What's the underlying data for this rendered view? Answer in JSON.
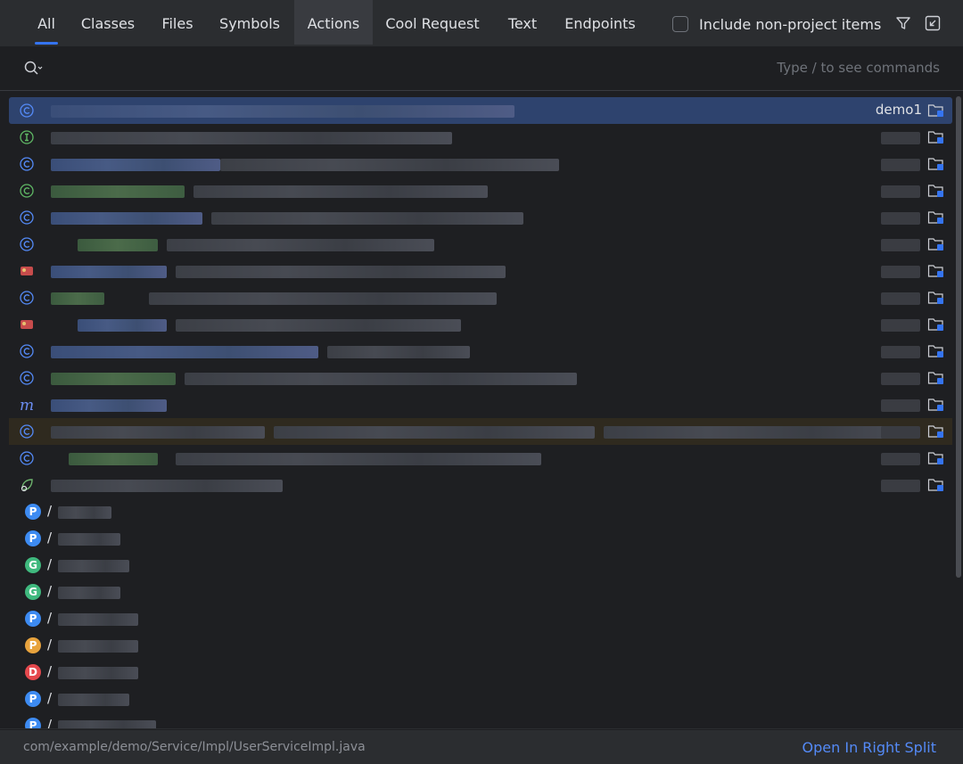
{
  "tabs": [
    {
      "label": "All"
    },
    {
      "label": "Classes"
    },
    {
      "label": "Files"
    },
    {
      "label": "Symbols"
    },
    {
      "label": "Actions"
    },
    {
      "label": "Cool Request"
    },
    {
      "label": "Text"
    },
    {
      "label": "Endpoints"
    }
  ],
  "include_non_project": {
    "label": "Include non-project items",
    "checked": false
  },
  "toolbar_icons": [
    "filter-icon",
    "collapse-window-icon"
  ],
  "search": {
    "value": "",
    "hint": "Type / to see commands"
  },
  "results": [
    {
      "icon": "class",
      "name": "",
      "module": "demo1",
      "selected": true
    },
    {
      "icon": "interface",
      "name": "",
      "module": ""
    },
    {
      "icon": "class",
      "name": "",
      "module": ""
    },
    {
      "icon": "class-green",
      "name": "",
      "module": ""
    },
    {
      "icon": "class",
      "name": "",
      "module": ""
    },
    {
      "icon": "class",
      "name": "",
      "module": ""
    },
    {
      "icon": "image",
      "name": "",
      "module": ""
    },
    {
      "icon": "class",
      "name": "",
      "module": ""
    },
    {
      "icon": "image",
      "name": "",
      "module": ""
    },
    {
      "icon": "class",
      "name": "",
      "module": ""
    },
    {
      "icon": "class",
      "name": "",
      "module": ""
    },
    {
      "icon": "method",
      "name": "",
      "module": ""
    },
    {
      "icon": "class",
      "name": "",
      "module": "",
      "highlight": true
    },
    {
      "icon": "class",
      "name": "",
      "module": ""
    },
    {
      "icon": "spring",
      "name": "",
      "module": ""
    }
  ],
  "endpoints": [
    {
      "method": "P",
      "color": "#3d8bf2",
      "path": "/"
    },
    {
      "method": "P",
      "color": "#3d8bf2",
      "path": "/"
    },
    {
      "method": "G",
      "color": "#3fb97e",
      "path": "/"
    },
    {
      "method": "G",
      "color": "#3fb97e",
      "path": "/"
    },
    {
      "method": "P",
      "color": "#3d8bf2",
      "path": "/"
    },
    {
      "method": "P",
      "color": "#e8a33d",
      "path": "/"
    },
    {
      "method": "D",
      "color": "#e5484d",
      "path": "/"
    },
    {
      "method": "P",
      "color": "#3d8bf2",
      "path": "/"
    },
    {
      "method": "P",
      "color": "#3d8bf2",
      "path": "/"
    }
  ],
  "footer": {
    "path": "com/example/demo/Service/Impl/UserServiceImpl.java",
    "link": "Open In Right Split"
  },
  "colors": {
    "accent": "#3574f0",
    "selection": "#2e436e",
    "link": "#548af7"
  }
}
